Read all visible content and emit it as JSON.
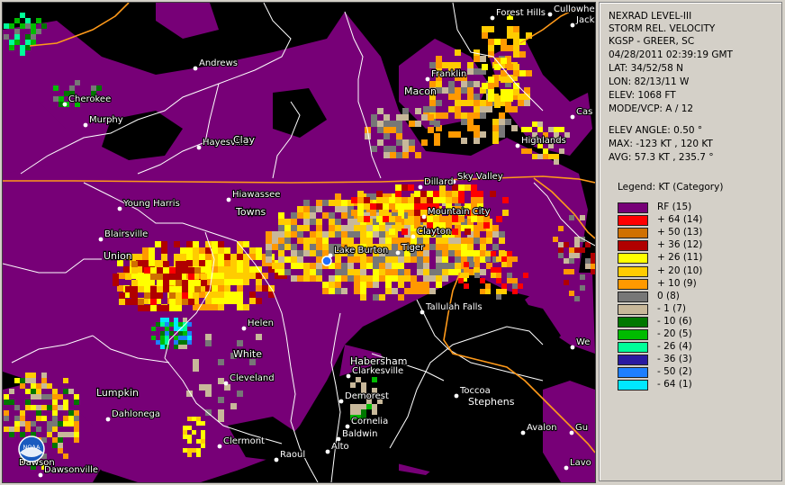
{
  "header": {
    "product": "NEXRAD LEVEL-III",
    "mode_name": "STORM REL. VELOCITY",
    "station": "KGSP - GREER, SC",
    "datetime": "04/28/2011 02:39:19 GMT",
    "lat": "LAT: 34/52/58 N",
    "lon": "LON: 82/13/11 W",
    "elev": "ELEV: 1068 FT",
    "mode_vcp": "MODE/VCP: A / 12",
    "elev_angle": "ELEV ANGLE: 0.50 °",
    "max": "MAX: -123 KT , 120 KT",
    "avg": "AVG: 57.3 KT , 235.7 °"
  },
  "legend": {
    "title": "Legend: KT (Category)",
    "items": [
      {
        "label": "RF  (15)",
        "color": "#770077"
      },
      {
        "label": "+ 64  (14)",
        "color": "#ff0000"
      },
      {
        "label": "+ 50  (13)",
        "color": "#d07000"
      },
      {
        "label": "+ 36  (12)",
        "color": "#b00000"
      },
      {
        "label": "+ 26  (11)",
        "color": "#ffff00"
      },
      {
        "label": "+ 20  (10)",
        "color": "#ffcc00"
      },
      {
        "label": "+ 10  (9)",
        "color": "#ff9900"
      },
      {
        "label": "0  (8)",
        "color": "#777777"
      },
      {
        "label": "- 1  (7)",
        "color": "#c8b89a"
      },
      {
        "label": "- 10  (6)",
        "color": "#007700"
      },
      {
        "label": "- 20  (5)",
        "color": "#00bb00"
      },
      {
        "label": "- 26  (4)",
        "color": "#00ff99"
      },
      {
        "label": "- 36  (3)",
        "color": "#2a1aa0"
      },
      {
        "label": "- 50  (2)",
        "color": "#1e7fff"
      },
      {
        "label": "- 64  (1)",
        "color": "#00e8ff"
      }
    ]
  },
  "map": {
    "towns": [
      "Forest Hills",
      "Cullowhee",
      "Jackson",
      "Andrews",
      "Franklin",
      "Cherokee",
      "Macon",
      "Murphy",
      "Cas",
      "Hayesville",
      "Clay",
      "Highlands",
      "Sky Valley",
      "Dillard",
      "Hiawassee",
      "Young Harris",
      "Towns",
      "Mountain City",
      "Blairsville",
      "Clayton",
      "Lake Burton",
      "Tiger",
      "Union",
      "Tallulah Falls",
      "Helen",
      "We",
      "White",
      "Habersham",
      "Clarkesville",
      "Cleveland",
      "Lumpkin",
      "Demorest",
      "Toccoa",
      "Stephens",
      "Dahlonega",
      "Cornelia",
      "Baldwin",
      "Avalon",
      "Gu",
      "Clermont",
      "Alto",
      "Raoul",
      "Dawsonville",
      "Lavo"
    ],
    "noaa_logo_text": "NOAA",
    "logo_caption": "Dawson"
  }
}
